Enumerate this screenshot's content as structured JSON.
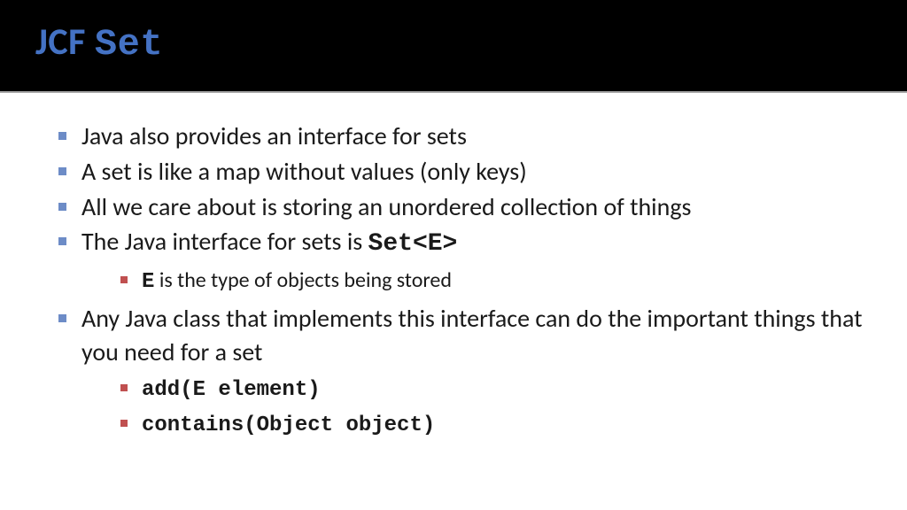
{
  "header": {
    "title_prefix": "JCF ",
    "title_code": "Set"
  },
  "bullets": {
    "b1": "Java also provides an interface for sets",
    "b2": "A set is like a map without values (only keys)",
    "b3": "All we care about is storing an unordered collection of things",
    "b4_prefix": "The Java interface for sets is ",
    "b4_code": "Set<E>",
    "b4_sub1_code": "E",
    "b4_sub1_rest": " is the type of objects being stored",
    "b5": "Any Java class that implements this interface can do the important things that you need for a set",
    "b5_sub1": "add(E element)",
    "b5_sub2": "contains(Object object)"
  }
}
